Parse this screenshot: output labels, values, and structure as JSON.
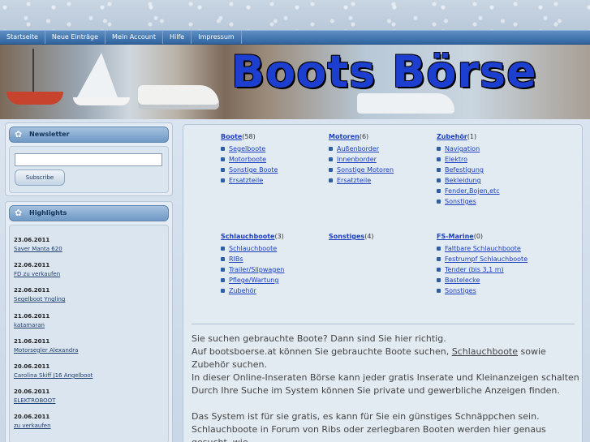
{
  "nav": [
    "Startseite",
    "Neue Einträge",
    "Mein Account",
    "Hilfe",
    "Impressum"
  ],
  "banner_title": "Boots Börse",
  "newsletter": {
    "title": "Newsletter",
    "button": "Subscribe",
    "input_value": ""
  },
  "highlights": {
    "title": "Highlights",
    "items": [
      {
        "date": "23.06.2011",
        "link": "Saver Manta 620"
      },
      {
        "date": "22.06.2011",
        "link": "FD zu verkaufen"
      },
      {
        "date": "22.06.2011",
        "link": "Segelboot Yngling"
      },
      {
        "date": "21.06.2011",
        "link": "katamaran"
      },
      {
        "date": "21.06.2011",
        "link": "Motorsegler Alexandra"
      },
      {
        "date": "20.06.2011",
        "link": "Carolina Skiff J16 Angelboot"
      },
      {
        "date": "20.06.2011",
        "link": "ELEKTROBOOT"
      },
      {
        "date": "20.06.2011",
        "link": "zu verkaufen"
      }
    ]
  },
  "categories": [
    {
      "name": "Boote",
      "count": "(58)",
      "items": [
        "Segelboote",
        "Motorboote",
        "Sonstige Boote",
        "Ersatzteile"
      ]
    },
    {
      "name": "Motoren",
      "count": "(6)",
      "items": [
        "Außenborder",
        "Innenborder",
        "Sonstige Motoren",
        "Ersatzteile"
      ]
    },
    {
      "name": "Zubehör",
      "count": "(1)",
      "items": [
        "Navigation",
        "Elektro",
        "Befestigung",
        "Bekleidung",
        "Fender,Bojen,etc",
        "Sonstiges"
      ]
    },
    {
      "name": "Schlauchboote",
      "count": "(3)",
      "items": [
        "Schlauchboote",
        "RIBs",
        "Trailer/Slipwagen",
        "Pflege/Wartung",
        "Zubehör"
      ]
    },
    {
      "name": "Sonstiges",
      "count": "(4)",
      "items": []
    },
    {
      "name": "FS-Marine",
      "count": "(0)",
      "items": [
        "Faltbare Schlauchboote",
        "Festrumpf Schlauchboote",
        "Tender (bis 3,1 m)",
        "Bastelecke",
        "Sonstiges"
      ]
    }
  ],
  "intro": {
    "line1": "Sie suchen gebrauchte Boote? Dann sind Sie hier richtig.",
    "line2_before": "Auf bootsboerse.at können Sie gebrauchte Boote suchen, ",
    "line2_link": "Schlauchboote",
    "line2_after": " sowie Zubehör suchen.",
    "line3": "In dieser Online-Inseraten Börse kann jeder gratis Inserate und Kleinanzeigen schalten",
    "line4": "Durch Ihre Suche im System können Sie private und gewerbliche Anzeigen finden.",
    "line5": "Das System ist für sie gratis, es kann für Sie ein günstiges Schnäppchen sein.",
    "line6": "Schlauchboote in Forum von Ribs oder zerlegbaren Booten werden hier genaus gesucht, wie"
  }
}
